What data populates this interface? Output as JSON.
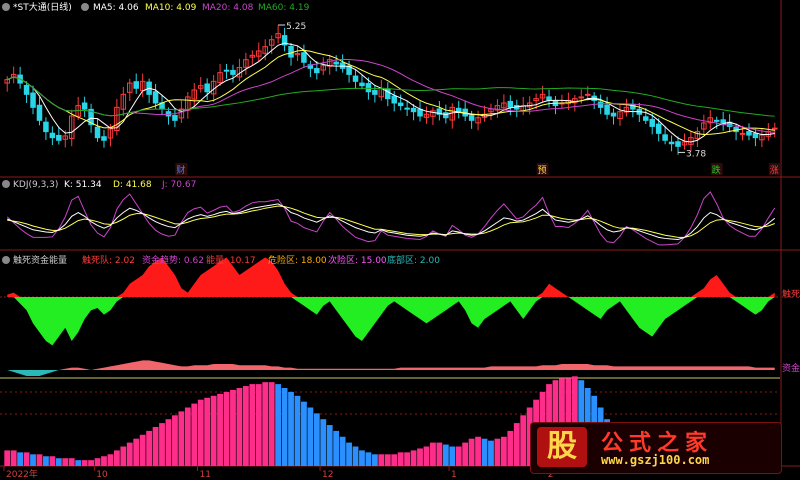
{
  "colors": {
    "bg": "#000000",
    "up": "#ff3a3a",
    "down": "#29d6e8",
    "ma5": "#ffffff",
    "ma10": "#ffff55",
    "ma20": "#cc44cc",
    "ma60": "#22aa22",
    "red_fill": "#ff1a1a",
    "green_fill": "#22ee22",
    "pink": "#ff2d8a",
    "blue": "#2a8fff",
    "salmon": "#f0666b",
    "teal": "#2ab8b8"
  },
  "main_panel": {
    "title": "*ST大通(日线)",
    "ma_labels": [
      {
        "text": "MA5: 4.06",
        "color": "#ffffff"
      },
      {
        "text": "MA10: 4.09",
        "color": "#ffff55"
      },
      {
        "text": "MA20: 4.08",
        "color": "#cc44cc"
      },
      {
        "text": "MA60: 4.19",
        "color": "#22aa22"
      }
    ],
    "high_label": "5.25",
    "low_label": "3.78",
    "markers": [
      {
        "text": "财",
        "color": "#3a7dff",
        "index": 27
      },
      {
        "text": "预",
        "color": "#ffd54a",
        "index": 83
      },
      {
        "text": "跌",
        "color": "#22cc22",
        "index": 110
      },
      {
        "text": "涨",
        "color": "#ff3a3a",
        "index": 119
      }
    ]
  },
  "kdj_panel": {
    "title": "KDJ(9,3,3)",
    "labels": [
      {
        "text": "K: 51.34",
        "color": "#ffffff"
      },
      {
        "text": "D: 41.68",
        "color": "#ffff55"
      },
      {
        "text": "J: 70.67",
        "color": "#cc44cc"
      }
    ]
  },
  "energy_panel": {
    "title": "触死资金能量",
    "labels": [
      {
        "text": "触死队: 2.02",
        "color": "#ff3a3a"
      },
      {
        "text": "资金趋势: 0.62",
        "color": "#cc44cc"
      },
      {
        "text": "能量: 10.17",
        "color": "#ff3a3a"
      },
      {
        "text": "危险区: 18.00",
        "color": "#ffaa00"
      },
      {
        "text": "次险区: 15.00",
        "color": "#ff55ff"
      },
      {
        "text": "底部区: 2.00",
        "color": "#2ab8b8"
      }
    ],
    "right_label_1": "触死",
    "right_label_2": "资金"
  },
  "x_axis": [
    {
      "text": "2022年",
      "index": 0
    },
    {
      "text": "10",
      "index": 14
    },
    {
      "text": "11",
      "index": 30
    },
    {
      "text": "12",
      "index": 49
    },
    {
      "text": "1",
      "index": 69
    },
    {
      "text": "2",
      "index": 84
    }
  ],
  "watermark": {
    "box": "股",
    "title": "公式之家",
    "url": "www.gszj100.com"
  },
  "chart_data": [
    {
      "type": "candlestick",
      "title": "*ST大通(日线)",
      "ylim": [
        3.6,
        5.4
      ],
      "high_annotation": 5.25,
      "low_annotation": 3.78,
      "close": [
        4.62,
        4.68,
        4.58,
        4.45,
        4.3,
        4.15,
        4.02,
        3.95,
        3.92,
        3.97,
        4.2,
        4.32,
        4.28,
        4.1,
        3.95,
        3.92,
        4.05,
        4.3,
        4.45,
        4.58,
        4.52,
        4.6,
        4.45,
        4.35,
        4.28,
        4.2,
        4.15,
        4.28,
        4.42,
        4.5,
        4.55,
        4.48,
        4.6,
        4.7,
        4.72,
        4.68,
        4.76,
        4.85,
        4.9,
        4.95,
        5.0,
        5.08,
        5.15,
        5.02,
        4.88,
        4.92,
        4.82,
        4.75,
        4.7,
        4.78,
        4.85,
        4.8,
        4.75,
        4.68,
        4.6,
        4.55,
        4.48,
        4.45,
        4.52,
        4.4,
        4.35,
        4.32,
        4.28,
        4.25,
        4.2,
        4.22,
        4.26,
        4.22,
        4.18,
        4.3,
        4.25,
        4.2,
        4.15,
        4.18,
        4.22,
        4.28,
        4.32,
        4.35,
        4.3,
        4.28,
        4.32,
        4.35,
        4.4,
        4.45,
        4.38,
        4.32,
        4.35,
        4.38,
        4.4,
        4.42,
        4.45,
        4.38,
        4.3,
        4.22,
        4.2,
        4.25,
        4.3,
        4.28,
        4.22,
        4.15,
        4.08,
        4.0,
        3.92,
        3.88,
        3.85,
        3.9,
        3.95,
        4.02,
        4.12,
        4.18,
        4.15,
        4.1,
        4.08,
        4.02,
        4.0,
        3.98,
        3.95,
        3.98,
        4.02,
        4.06
      ],
      "ma5_last": 4.06,
      "ma10_last": 4.09,
      "ma20_last": 4.08,
      "ma60_last": 4.19
    },
    {
      "type": "line",
      "title": "KDJ(9,3,3)",
      "ylim": [
        0,
        100
      ],
      "series": [
        {
          "name": "K",
          "values": [
            50,
            45,
            40,
            35,
            30,
            28,
            26,
            25,
            30,
            40,
            55,
            62,
            55,
            45,
            38,
            33,
            38,
            52,
            62,
            70,
            66,
            60,
            52,
            45,
            40,
            36,
            34,
            42,
            50,
            55,
            58,
            55,
            58,
            62,
            64,
            60,
            62,
            66,
            70,
            72,
            74,
            76,
            78,
            72,
            62,
            58,
            52,
            48,
            44,
            50,
            56,
            52,
            46,
            40,
            34,
            30,
            26,
            24,
            30,
            26,
            24,
            22,
            20,
            19,
            18,
            20,
            24,
            22,
            20,
            28,
            26,
            22,
            20,
            22,
            28,
            36,
            44,
            52,
            50,
            46,
            48,
            54,
            60,
            68,
            58,
            48,
            46,
            44,
            46,
            50,
            56,
            48,
            38,
            30,
            26,
            28,
            34,
            32,
            28,
            24,
            20,
            16,
            14,
            13,
            12,
            16,
            24,
            36,
            52,
            62,
            58,
            50,
            44,
            40,
            36,
            32,
            30,
            34,
            42,
            51.34
          ]
        },
        {
          "name": "D",
          "values": [
            48,
            46,
            44,
            41,
            37,
            34,
            31,
            29,
            29,
            33,
            40,
            47,
            50,
            48,
            45,
            41,
            40,
            44,
            50,
            57,
            60,
            60,
            57,
            53,
            49,
            45,
            41,
            41,
            44,
            48,
            51,
            52,
            54,
            57,
            59,
            59,
            60,
            62,
            65,
            67,
            70,
            72,
            74,
            73,
            70,
            66,
            61,
            57,
            53,
            52,
            53,
            53,
            51,
            47,
            43,
            39,
            35,
            31,
            31,
            29,
            27,
            25,
            23,
            22,
            21,
            21,
            22,
            22,
            21,
            23,
            24,
            23,
            22,
            22,
            24,
            28,
            33,
            39,
            43,
            44,
            45,
            48,
            52,
            57,
            57,
            54,
            51,
            49,
            48,
            49,
            51,
            50,
            46,
            41,
            36,
            33,
            33,
            33,
            31,
            29,
            26,
            23,
            20,
            18,
            16,
            16,
            19,
            25,
            34,
            43,
            48,
            49,
            47,
            45,
            42,
            39,
            36,
            35,
            37,
            41.68
          ]
        }
      ]
    },
    {
      "type": "area",
      "title": "触死资金能量",
      "series": [
        {
          "name": "触死队",
          "values": [
            1,
            2,
            -3,
            -6,
            -12,
            -16,
            -20,
            -22,
            -18,
            -14,
            -20,
            -16,
            -10,
            -6,
            -5,
            -8,
            -6,
            -2,
            2,
            6,
            8,
            10,
            14,
            16,
            18,
            14,
            10,
            4,
            2,
            6,
            10,
            12,
            14,
            16,
            18,
            14,
            10,
            12,
            14,
            16,
            18,
            16,
            12,
            6,
            2,
            -2,
            -4,
            -6,
            -8,
            -4,
            -2,
            -6,
            -10,
            -14,
            -18,
            -20,
            -16,
            -12,
            -8,
            -4,
            -2,
            -4,
            -6,
            -8,
            -10,
            -12,
            -10,
            -8,
            -6,
            -4,
            -2,
            -6,
            -12,
            -14,
            -10,
            -8,
            -6,
            -4,
            -2,
            -6,
            -10,
            -6,
            -2,
            2,
            6,
            4,
            2,
            0,
            -2,
            -4,
            -6,
            -8,
            -10,
            -6,
            -4,
            -2,
            -6,
            -10,
            -14,
            -16,
            -18,
            -14,
            -10,
            -8,
            -6,
            -4,
            -2,
            2,
            4,
            8,
            10,
            6,
            2,
            -2,
            -4,
            -6,
            -8,
            -6,
            -2,
            2
          ]
        },
        {
          "name": "资金",
          "values": [
            0,
            -1,
            -2,
            -3,
            -3,
            -3,
            -2,
            -1,
            0,
            1,
            2,
            2,
            1,
            0,
            1,
            2,
            3,
            4,
            5,
            6,
            7,
            8,
            8,
            7,
            6,
            5,
            4,
            3,
            3,
            4,
            4,
            4,
            5,
            5,
            5,
            5,
            4,
            4,
            4,
            4,
            4,
            3,
            3,
            2,
            2,
            1,
            1,
            1,
            1,
            1,
            1,
            1,
            1,
            1,
            1,
            1,
            1,
            1,
            1,
            1,
            1,
            2,
            2,
            2,
            2,
            2,
            2,
            2,
            2,
            2,
            2,
            2,
            2,
            2,
            2,
            3,
            3,
            3,
            3,
            3,
            3,
            3,
            3,
            4,
            4,
            4,
            5,
            5,
            5,
            5,
            5,
            4,
            4,
            4,
            3,
            3,
            3,
            3,
            3,
            3,
            3,
            3,
            3,
            3,
            3,
            3,
            3,
            3,
            3,
            3,
            3,
            3,
            3,
            3,
            3,
            3,
            2,
            2,
            2,
            2
          ]
        },
        {
          "name": "能量",
          "values": [
            8,
            8,
            7,
            7,
            6,
            6,
            5,
            5,
            4,
            4,
            4,
            3,
            3,
            3,
            4,
            5,
            6,
            8,
            10,
            12,
            14,
            16,
            18,
            20,
            22,
            24,
            26,
            28,
            30,
            32,
            34,
            35,
            36,
            37,
            38,
            39,
            40,
            41,
            42,
            42,
            43,
            43,
            42,
            40,
            38,
            36,
            33,
            30,
            27,
            24,
            21,
            18,
            15,
            12,
            10,
            8,
            7,
            6,
            6,
            6,
            6,
            7,
            7,
            8,
            9,
            10,
            12,
            12,
            11,
            10,
            10,
            12,
            14,
            15,
            14,
            13,
            14,
            15,
            18,
            22,
            26,
            30,
            34,
            38,
            42,
            44,
            45,
            45,
            46,
            44,
            40,
            36,
            30,
            24,
            18,
            12,
            8,
            4,
            3,
            2,
            2,
            2,
            2,
            2,
            2,
            2,
            2,
            2,
            2,
            2,
            2,
            2,
            2,
            2,
            2,
            2,
            2,
            2,
            2,
            2
          ]
        }
      ]
    }
  ]
}
